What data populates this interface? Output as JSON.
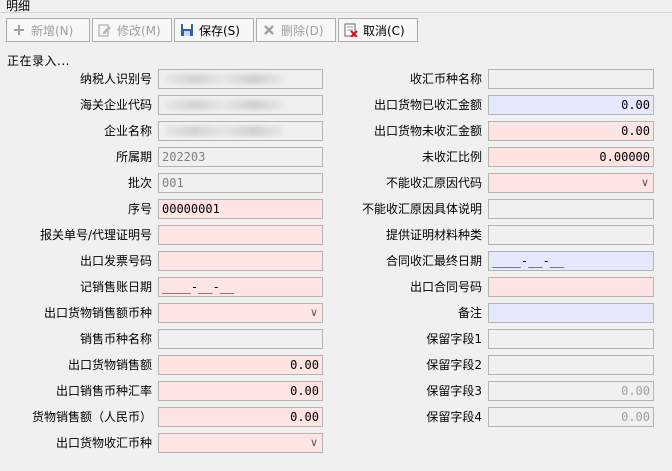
{
  "panel": {
    "title": "明细"
  },
  "toolbar": {
    "add_label": "新增(N)",
    "edit_label": "修改(M)",
    "save_label": "保存(S)",
    "delete_label": "删除(D)",
    "cancel_label": "取消(C)"
  },
  "status_text": "正在录入...",
  "left_fields": [
    {
      "label": "纳税人识别号",
      "value": "",
      "style": "grey",
      "obscured": true
    },
    {
      "label": "海关企业代码",
      "value": "",
      "style": "grey",
      "obscured": true
    },
    {
      "label": "企业名称",
      "value": "",
      "style": "grey",
      "obscured": true
    },
    {
      "label": "所属期",
      "value": "202203",
      "style": "grey"
    },
    {
      "label": "批次",
      "value": "001",
      "style": "grey"
    },
    {
      "label": "序号",
      "value": "00000001",
      "style": "pink"
    },
    {
      "label": "报关单号/代理证明号",
      "value": "",
      "style": "pink"
    },
    {
      "label": "出口发票号码",
      "value": "",
      "style": "pink"
    },
    {
      "label": "记销售账日期",
      "value": "____-__-__",
      "style": "pink"
    },
    {
      "label": "出口货物销售额币种",
      "value": "",
      "style": "pink",
      "combo": true
    },
    {
      "label": "销售币种名称",
      "value": "",
      "style": "grey"
    },
    {
      "label": "出口货物销售额",
      "value": "0.00",
      "style": "pink",
      "num": true
    },
    {
      "label": "出口销售币种汇率",
      "value": "0.00",
      "style": "pink",
      "num": true
    },
    {
      "label": "货物销售额（人民币）",
      "value": "0.00",
      "style": "pink",
      "num": true
    },
    {
      "label": "出口货物收汇币种",
      "value": "",
      "style": "pink",
      "combo": true
    }
  ],
  "right_fields": [
    {
      "label": "收汇币种名称",
      "value": "",
      "style": "grey"
    },
    {
      "label": "出口货物已收汇金额",
      "value": "0.00",
      "style": "blue",
      "num": true
    },
    {
      "label": "出口货物未收汇金额",
      "value": "0.00",
      "style": "pink",
      "num": true
    },
    {
      "label": "未收汇比例",
      "value": "0.00000",
      "style": "pink",
      "num": true
    },
    {
      "label": "不能收汇原因代码",
      "value": "",
      "style": "pink",
      "combo": true
    },
    {
      "label": "不能收汇原因具体说明",
      "value": "",
      "style": "grey"
    },
    {
      "label": "提供证明材料种类",
      "value": "",
      "style": "grey"
    },
    {
      "label": "合同收汇最终日期",
      "value": "____-__-__",
      "style": "blue"
    },
    {
      "label": "出口合同号码",
      "value": "",
      "style": "pink"
    },
    {
      "label": "备注",
      "value": "",
      "style": "blue"
    },
    {
      "label": "保留字段1",
      "value": "",
      "style": "grey"
    },
    {
      "label": "保留字段2",
      "value": "",
      "style": "grey"
    },
    {
      "label": "保留字段3",
      "value": "0.00",
      "style": "grey",
      "greynum": true
    },
    {
      "label": "保留字段4",
      "value": "0.00",
      "style": "grey",
      "greynum": true
    }
  ]
}
